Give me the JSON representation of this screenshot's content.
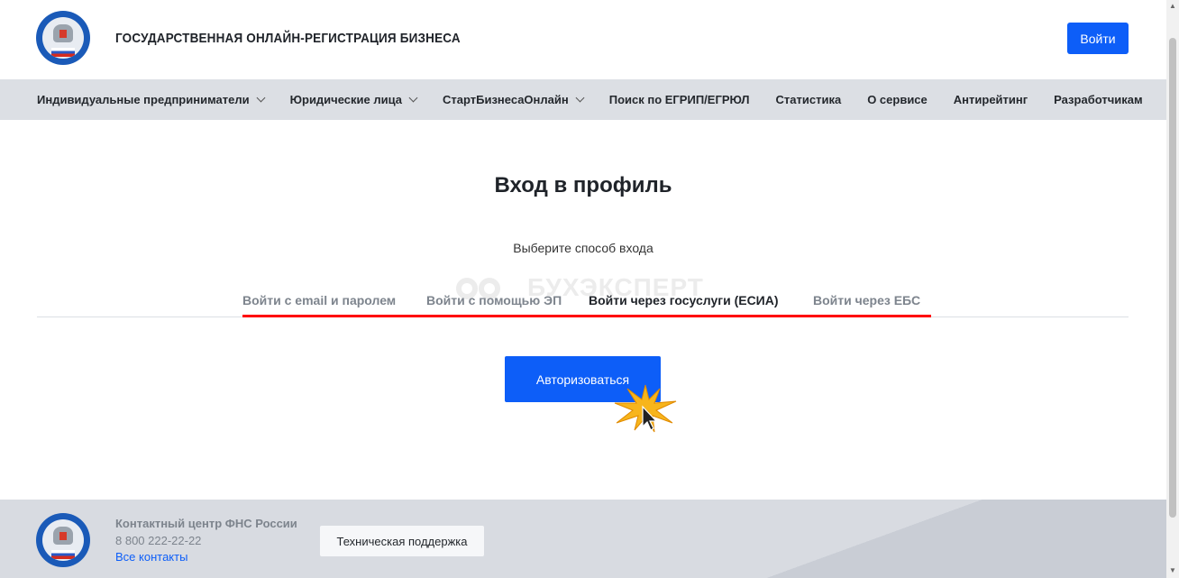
{
  "header": {
    "title": "ГОСУДАРСТВЕННАЯ ОНЛАЙН-РЕГИСТРАЦИЯ БИЗНЕСА",
    "login_label": "Войти"
  },
  "nav": [
    {
      "label": "Индивидуальные предприниматели",
      "dropdown": true
    },
    {
      "label": "Юридические лица",
      "dropdown": true
    },
    {
      "label": "СтартБизнесаОнлайн",
      "dropdown": true
    },
    {
      "label": "Поиск по ЕГРИП/ЕГРЮЛ",
      "dropdown": false
    },
    {
      "label": "Статистика",
      "dropdown": false
    },
    {
      "label": "О сервисе",
      "dropdown": false
    },
    {
      "label": "Антирейтинг",
      "dropdown": false
    },
    {
      "label": "Разработчикам",
      "dropdown": false
    }
  ],
  "main": {
    "title": "Вход в профиль",
    "subtitle": "Выберите способ входа",
    "tabs": [
      {
        "label": "Войти с email и паролем",
        "active": false
      },
      {
        "label": "Войти с помощью ЭП",
        "active": false
      },
      {
        "label": "Войти через госуслуги (ЕСИА)",
        "active": true
      },
      {
        "label": "Войти через ЕБС",
        "active": false
      }
    ],
    "authorize_label": "Авторизоваться",
    "watermark": "БУХЭКСПЕРТ"
  },
  "footer": {
    "contact_title": "Контактный центр ФНС России",
    "phone": "8 800 222-22-22",
    "all_contacts": "Все контакты",
    "support_label": "Техническая поддержка"
  },
  "colors": {
    "accent": "#0d5ef8",
    "highlight": "#ff0000",
    "nav_bg": "#dcdfe4"
  }
}
